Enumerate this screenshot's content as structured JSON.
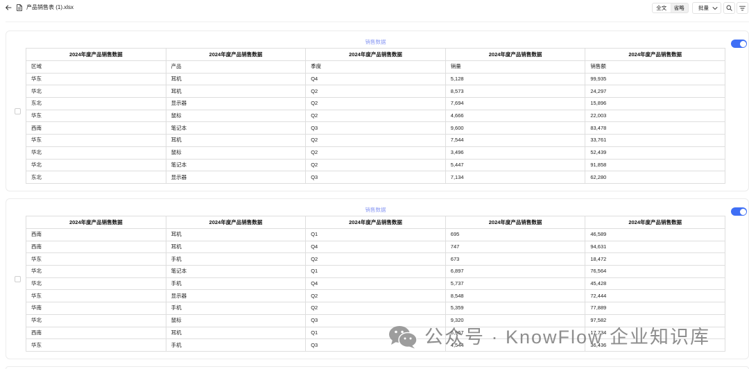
{
  "header": {
    "title": "产品销售表 (1).xlsx",
    "icons": {
      "back": "arrow-left-icon",
      "file": "file-icon"
    }
  },
  "toolbar": {
    "view_modes": [
      {
        "label": "全文",
        "selected": true
      },
      {
        "label": "省略",
        "selected": false
      }
    ],
    "batch": {
      "label": "批量",
      "icon": "chevron-down-icon"
    },
    "search_icon": "search-icon",
    "filter_icon": "filter-icon"
  },
  "colors": {
    "accent": "#3f6ff5",
    "sheet_title": "#8b9af3",
    "border": "#dedede"
  },
  "sheets": [
    {
      "title": "销售数据",
      "selected": false,
      "enabled": true,
      "columns": [
        "2024年度产品销售数据",
        "2024年度产品销售数据",
        "2024年度产品销售数据",
        "2024年度产品销售数据",
        "2024年度产品销售数据"
      ],
      "rows": [
        [
          "区域",
          "产品",
          "季度",
          "销量",
          "销售额"
        ],
        [
          "华东",
          "耳机",
          "Q4",
          "5,128",
          "99,935"
        ],
        [
          "华北",
          "耳机",
          "Q2",
          "8,573",
          "24,297"
        ],
        [
          "东北",
          "显示器",
          "Q2",
          "7,694",
          "15,896"
        ],
        [
          "华东",
          "鼠标",
          "Q2",
          "4,666",
          "22,003"
        ],
        [
          "西南",
          "笔记本",
          "Q3",
          "9,600",
          "83,478"
        ],
        [
          "华东",
          "耳机",
          "Q2",
          "7,544",
          "33,761"
        ],
        [
          "华北",
          "鼠标",
          "Q2",
          "3,496",
          "52,439"
        ],
        [
          "华北",
          "笔记本",
          "Q2",
          "5,447",
          "91,858"
        ],
        [
          "东北",
          "显示器",
          "Q3",
          "7,134",
          "62,280"
        ]
      ]
    },
    {
      "title": "销售数据",
      "selected": false,
      "enabled": true,
      "columns": [
        "2024年度产品销售数据",
        "2024年度产品销售数据",
        "2024年度产品销售数据",
        "2024年度产品销售数据",
        "2024年度产品销售数据"
      ],
      "rows": [
        [
          "西南",
          "耳机",
          "Q1",
          "695",
          "46,589"
        ],
        [
          "西南",
          "耳机",
          "Q4",
          "747",
          "94,631"
        ],
        [
          "华东",
          "手机",
          "Q2",
          "673",
          "18,472"
        ],
        [
          "华北",
          "笔记本",
          "Q1",
          "6,897",
          "76,564"
        ],
        [
          "华北",
          "手机",
          "Q4",
          "5,737",
          "45,428"
        ],
        [
          "华东",
          "显示器",
          "Q2",
          "8,548",
          "72,444"
        ],
        [
          "华南",
          "手机",
          "Q2",
          "5,359",
          "77,889"
        ],
        [
          "华北",
          "鼠标",
          "Q3",
          "9,320",
          "97,582"
        ],
        [
          "西南",
          "耳机",
          "Q1",
          "6,967",
          "17,734"
        ],
        [
          "华东",
          "手机",
          "Q3",
          "4,544",
          "36,436"
        ]
      ]
    }
  ],
  "watermark": {
    "icon": "wechat-icon",
    "text": "公众号 · KnowFlow 企业知识库"
  }
}
